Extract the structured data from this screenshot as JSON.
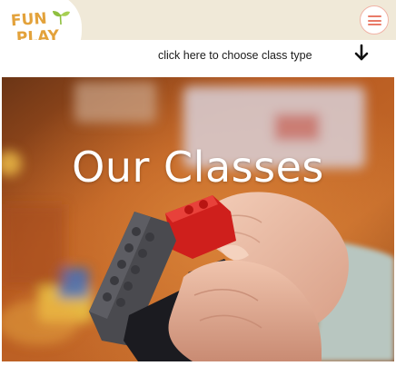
{
  "header": {
    "logo": {
      "line1": "FUN",
      "line2": "PLAY",
      "icon": "leaf-icon"
    },
    "menu_button": {
      "icon": "hamburger-menu-icon"
    }
  },
  "hint": {
    "text": "click here to choose class type",
    "icon": "arrow-down-icon"
  },
  "hero": {
    "title": "Our Classes",
    "image": "hands-holding-lego-bricks"
  },
  "colors": {
    "top_bar": "#f0e9d8",
    "logo_text": "#e3a23b",
    "logo_leaf": "#8fbf3f",
    "menu_accent": "#e97b68",
    "hero_title": "#ffffff"
  }
}
